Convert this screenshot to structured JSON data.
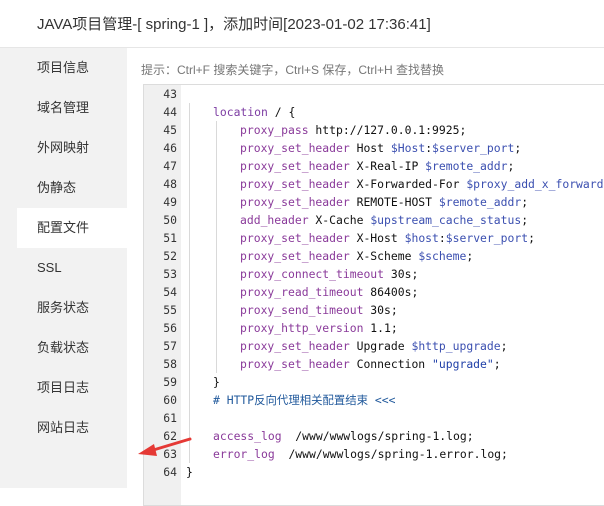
{
  "dialog": {
    "title": "JAVA项目管理-[ spring-1 ]，添加时间[2023-01-02 17:36:41]"
  },
  "sidebar": {
    "items": [
      {
        "label": "项目信息",
        "active": false
      },
      {
        "label": "域名管理",
        "active": false
      },
      {
        "label": "外网映射",
        "active": false
      },
      {
        "label": "伪静态",
        "active": false
      },
      {
        "label": "配置文件",
        "active": true
      },
      {
        "label": "SSL",
        "active": false
      },
      {
        "label": "服务状态",
        "active": false
      },
      {
        "label": "负载状态",
        "active": false
      },
      {
        "label": "项目日志",
        "active": false
      },
      {
        "label": "网站日志",
        "active": false
      }
    ]
  },
  "hint": "提示：Ctrl+F 搜索关键字，Ctrl+S 保存，Ctrl+H 查找替换",
  "editor": {
    "lines": [
      {
        "num": "43",
        "indent": 0,
        "parts": []
      },
      {
        "num": "44",
        "indent": 1,
        "parts": [
          {
            "t": "location",
            "c": "kw"
          },
          {
            "t": " / {",
            "c": "txt"
          }
        ]
      },
      {
        "num": "45",
        "indent": 2,
        "parts": [
          {
            "t": "proxy_pass",
            "c": "dir"
          },
          {
            "t": " http://127.0.0.1:9925;",
            "c": "txt"
          }
        ]
      },
      {
        "num": "46",
        "indent": 2,
        "parts": [
          {
            "t": "proxy_set_header",
            "c": "dir"
          },
          {
            "t": " Host ",
            "c": "txt"
          },
          {
            "t": "$Host",
            "c": "var"
          },
          {
            "t": ":",
            "c": "txt"
          },
          {
            "t": "$server_port",
            "c": "var"
          },
          {
            "t": ";",
            "c": "txt"
          }
        ]
      },
      {
        "num": "47",
        "indent": 2,
        "parts": [
          {
            "t": "proxy_set_header",
            "c": "dir"
          },
          {
            "t": " X-Real-IP ",
            "c": "txt"
          },
          {
            "t": "$remote_addr",
            "c": "var"
          },
          {
            "t": ";",
            "c": "txt"
          }
        ]
      },
      {
        "num": "48",
        "indent": 2,
        "parts": [
          {
            "t": "proxy_set_header",
            "c": "dir"
          },
          {
            "t": " X-Forwarded-For ",
            "c": "txt"
          },
          {
            "t": "$proxy_add_x_forwarded_",
            "c": "var"
          }
        ]
      },
      {
        "num": "49",
        "indent": 2,
        "parts": [
          {
            "t": "proxy_set_header",
            "c": "dir"
          },
          {
            "t": " REMOTE-HOST ",
            "c": "txt"
          },
          {
            "t": "$remote_addr",
            "c": "var"
          },
          {
            "t": ";",
            "c": "txt"
          }
        ]
      },
      {
        "num": "50",
        "indent": 2,
        "parts": [
          {
            "t": "add_header",
            "c": "dir"
          },
          {
            "t": " X-Cache ",
            "c": "txt"
          },
          {
            "t": "$upstream_cache_status",
            "c": "var"
          },
          {
            "t": ";",
            "c": "txt"
          }
        ]
      },
      {
        "num": "51",
        "indent": 2,
        "parts": [
          {
            "t": "proxy_set_header",
            "c": "dir"
          },
          {
            "t": " X-Host ",
            "c": "txt"
          },
          {
            "t": "$host",
            "c": "var"
          },
          {
            "t": ":",
            "c": "txt"
          },
          {
            "t": "$server_port",
            "c": "var"
          },
          {
            "t": ";",
            "c": "txt"
          }
        ]
      },
      {
        "num": "52",
        "indent": 2,
        "parts": [
          {
            "t": "proxy_set_header",
            "c": "dir"
          },
          {
            "t": " X-Scheme ",
            "c": "txt"
          },
          {
            "t": "$scheme",
            "c": "var"
          },
          {
            "t": ";",
            "c": "txt"
          }
        ]
      },
      {
        "num": "53",
        "indent": 2,
        "parts": [
          {
            "t": "proxy_connect_timeout",
            "c": "dir"
          },
          {
            "t": " 30s;",
            "c": "txt"
          }
        ]
      },
      {
        "num": "54",
        "indent": 2,
        "parts": [
          {
            "t": "proxy_read_timeout",
            "c": "dir"
          },
          {
            "t": " 86400s;",
            "c": "txt"
          }
        ]
      },
      {
        "num": "55",
        "indent": 2,
        "parts": [
          {
            "t": "proxy_send_timeout",
            "c": "dir"
          },
          {
            "t": " 30s;",
            "c": "txt"
          }
        ]
      },
      {
        "num": "56",
        "indent": 2,
        "parts": [
          {
            "t": "proxy_http_version",
            "c": "dir"
          },
          {
            "t": " 1.1;",
            "c": "txt"
          }
        ]
      },
      {
        "num": "57",
        "indent": 2,
        "parts": [
          {
            "t": "proxy_set_header",
            "c": "dir"
          },
          {
            "t": " Upgrade ",
            "c": "txt"
          },
          {
            "t": "$http_upgrade",
            "c": "var"
          },
          {
            "t": ";",
            "c": "txt"
          }
        ]
      },
      {
        "num": "58",
        "indent": 2,
        "parts": [
          {
            "t": "proxy_set_header",
            "c": "dir"
          },
          {
            "t": " Connection ",
            "c": "txt"
          },
          {
            "t": "\"upgrade\"",
            "c": "str"
          },
          {
            "t": ";",
            "c": "txt"
          }
        ]
      },
      {
        "num": "59",
        "indent": 1,
        "parts": [
          {
            "t": "}",
            "c": "txt"
          }
        ]
      },
      {
        "num": "60",
        "indent": 1,
        "parts": [
          {
            "t": "# HTTP反向代理相关配置结束 <<<",
            "c": "cm"
          }
        ]
      },
      {
        "num": "61",
        "indent": 1,
        "parts": []
      },
      {
        "num": "62",
        "indent": 1,
        "parts": [
          {
            "t": "access_log",
            "c": "dir"
          },
          {
            "t": "  /www/wwwlogs/spring-1.log;",
            "c": "txt"
          }
        ]
      },
      {
        "num": "63",
        "indent": 1,
        "parts": [
          {
            "t": "error_log",
            "c": "dir"
          },
          {
            "t": "  /www/wwwlogs/spring-1.error.log;",
            "c": "txt"
          }
        ]
      },
      {
        "num": "64",
        "indent": 0,
        "parts": [
          {
            "t": "}",
            "c": "txt"
          }
        ]
      }
    ]
  },
  "colors": {
    "arrow": "#e53935",
    "active_sidebar_bg": "#ffffff",
    "sidebar_bg": "#f2f2f2"
  }
}
